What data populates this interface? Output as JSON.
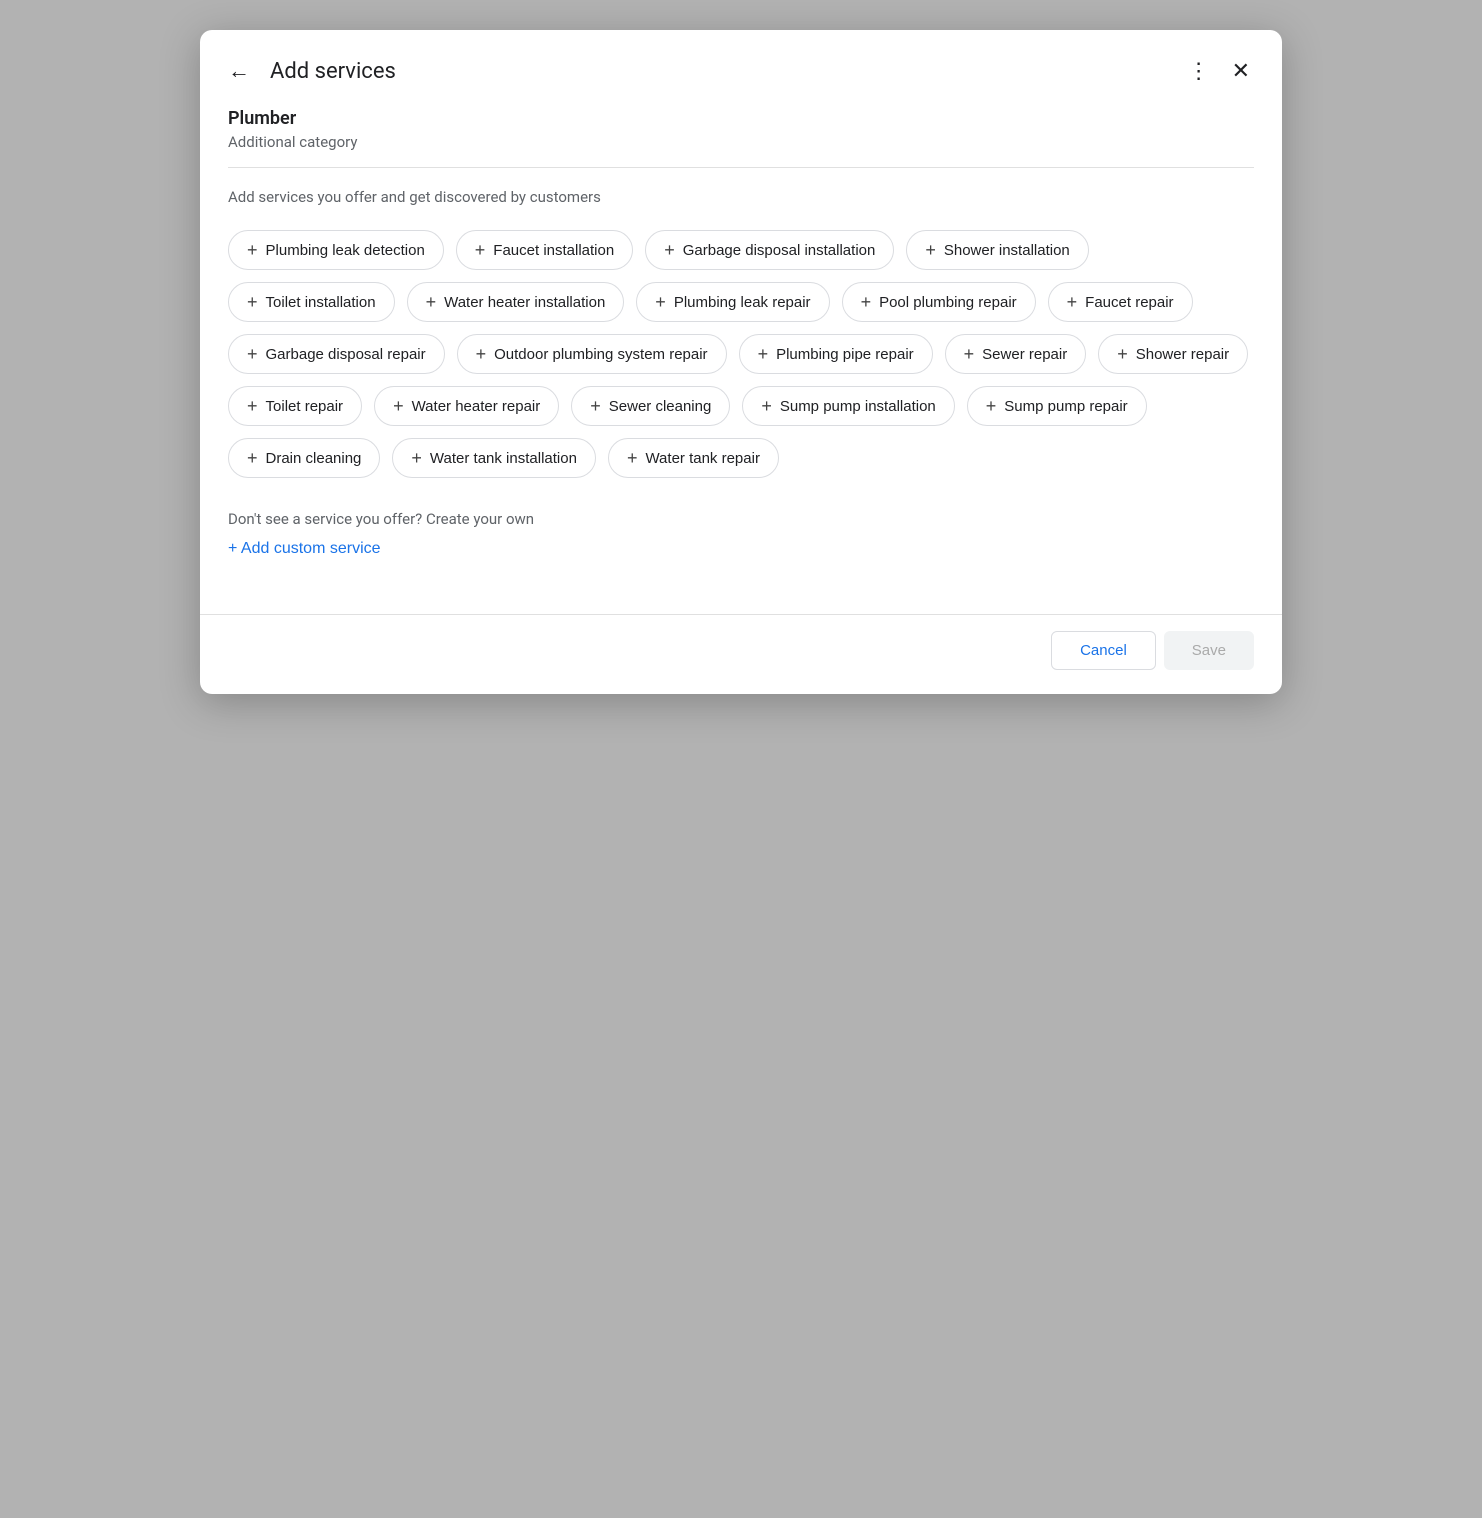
{
  "dialog": {
    "title": "Add services",
    "back_label": "←",
    "more_label": "⋮",
    "close_label": "✕"
  },
  "category": {
    "name": "Plumber",
    "subtitle": "Additional category"
  },
  "description": "Add services you offer and get discovered by customers",
  "services": [
    "Plumbing leak detection",
    "Faucet installation",
    "Garbage disposal installation",
    "Shower installation",
    "Toilet installation",
    "Water heater installation",
    "Plumbing leak repair",
    "Pool plumbing repair",
    "Faucet repair",
    "Garbage disposal repair",
    "Outdoor plumbing system repair",
    "Plumbing pipe repair",
    "Sewer repair",
    "Shower repair",
    "Toilet repair",
    "Water heater repair",
    "Sewer cleaning",
    "Sump pump installation",
    "Sump pump repair",
    "Drain cleaning",
    "Water tank installation",
    "Water tank repair"
  ],
  "custom_service": {
    "hint": "Don't see a service you offer? Create your own",
    "button_label": "+ Add custom service"
  },
  "footer": {
    "cancel_label": "Cancel",
    "save_label": "Save"
  },
  "icons": {
    "back": "←",
    "more": "⋮",
    "close": "✕",
    "plus": "+"
  }
}
